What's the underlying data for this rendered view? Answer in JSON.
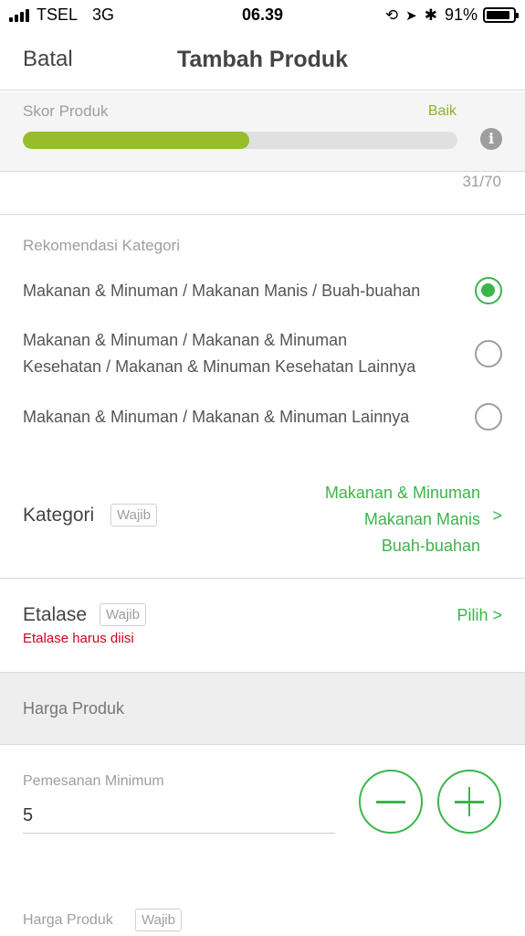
{
  "status_bar": {
    "carrier": "TSEL",
    "network": "3G",
    "time": "06.39",
    "battery": "91%",
    "battery_level": 0.91
  },
  "nav": {
    "cancel": "Batal",
    "title": "Tambah Produk"
  },
  "score": {
    "label": "Skor Produk",
    "status": "Baik",
    "progress": 0.52,
    "counter": "31/70",
    "colors": {
      "fill": "#97bd2a",
      "status": "#8fb325"
    }
  },
  "recommendation": {
    "title": "Rekomendasi Kategori",
    "options": [
      {
        "line1": "Makanan & Minuman / Makanan Manis / Buah-buahan",
        "line2": "",
        "selected": true
      },
      {
        "line1": "Makanan & Minuman / Makanan & Minuman",
        "line2": "Kesehatan / Makanan & Minuman Kesehatan Lainnya",
        "selected": false
      },
      {
        "line1": "Makanan & Minuman / Makanan & Minuman Lainnya",
        "line2": "",
        "selected": false
      }
    ]
  },
  "kategori": {
    "label": "Kategori",
    "badge": "Wajib",
    "value_line1": "Makanan & Minuman",
    "value_line2": "Makanan Manis",
    "value_line3": "Buah-buahan",
    "chevron": ">"
  },
  "etalase": {
    "label": "Etalase",
    "badge": "Wajib",
    "action": "Pilih >",
    "error": "Etalase harus diisi"
  },
  "harga_section": {
    "title": "Harga Produk"
  },
  "pemesanan": {
    "label": "Pemesanan Minimum",
    "value": "5",
    "minus_icon": "minus-circle-icon",
    "plus_icon": "plus-circle-icon"
  },
  "harga_field": {
    "label": "Harga Produk",
    "badge": "Wajib"
  },
  "accent_color": "#3cb54a",
  "error_color": "#d0021b"
}
